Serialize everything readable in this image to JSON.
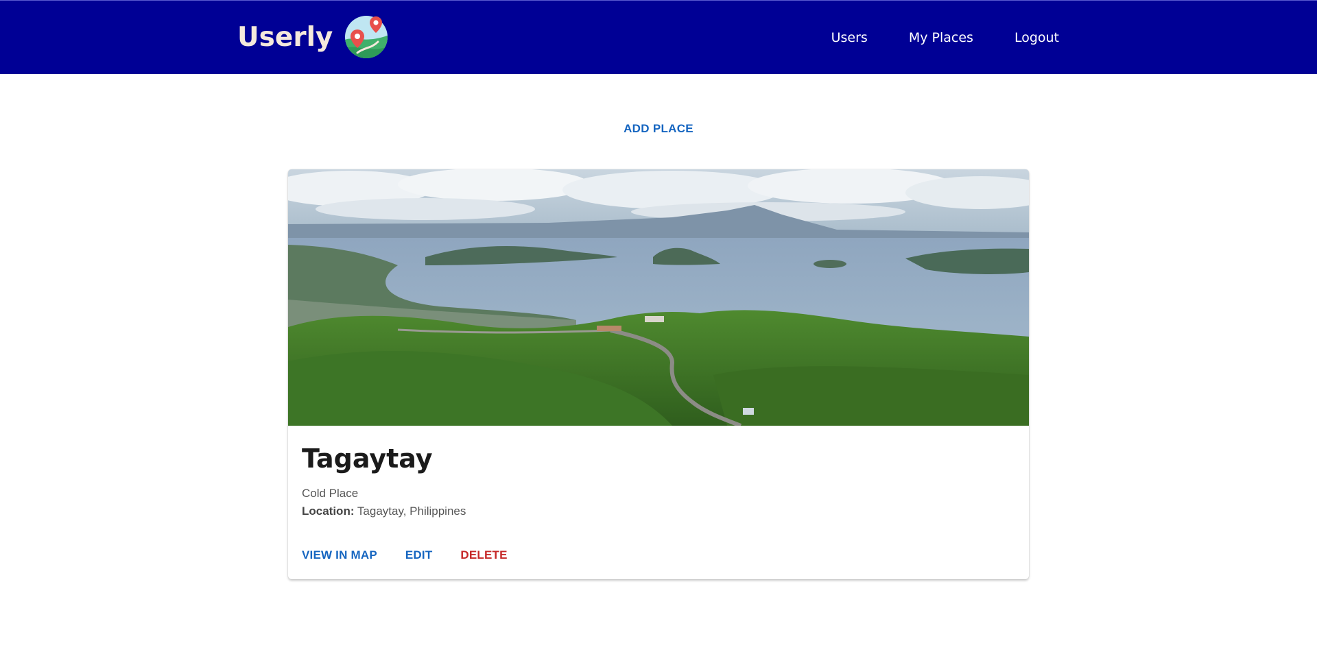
{
  "header": {
    "brand": "Userly",
    "logo_icon": "map-pins-logo-icon",
    "nav": [
      "Users",
      "My Places",
      "Logout"
    ],
    "background": "#000095"
  },
  "main": {
    "add_place_label": "ADD PLACE"
  },
  "place": {
    "image_alt": "Tagaytay",
    "title": "Tagaytay",
    "description": "Cold Place",
    "location_label": "Location:",
    "location_value": "Tagaytay, Philippines",
    "actions": {
      "view_in_map": "VIEW IN MAP",
      "edit": "EDIT",
      "delete": "DELETE"
    }
  },
  "colors": {
    "primary_action": "#1565c0",
    "danger_action": "#c62828",
    "brand_text": "#f4e9dc"
  }
}
